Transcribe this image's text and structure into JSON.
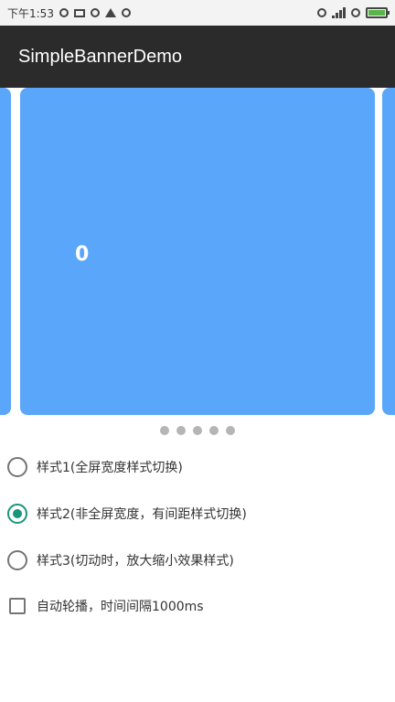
{
  "status_bar": {
    "time": "下午1:53",
    "battery_level": 1.0,
    "battery_color": "#58b548"
  },
  "app_bar": {
    "title": "SimpleBannerDemo",
    "background": "#2b2b2b"
  },
  "banner": {
    "current_label": "0",
    "card_color": "#5aa6fa",
    "indicator_count": 5
  },
  "options": [
    {
      "label": "样式1(全屏宽度样式切换)",
      "checked": false
    },
    {
      "label": "样式2(非全屏宽度，有间距样式切换)",
      "checked": true
    },
    {
      "label": "样式3(切动时，放大缩小效果样式)",
      "checked": false
    }
  ],
  "autoplay": {
    "label": "自动轮播，时间间隔1000ms",
    "checked": false
  },
  "colors": {
    "accent": "#17957d"
  }
}
